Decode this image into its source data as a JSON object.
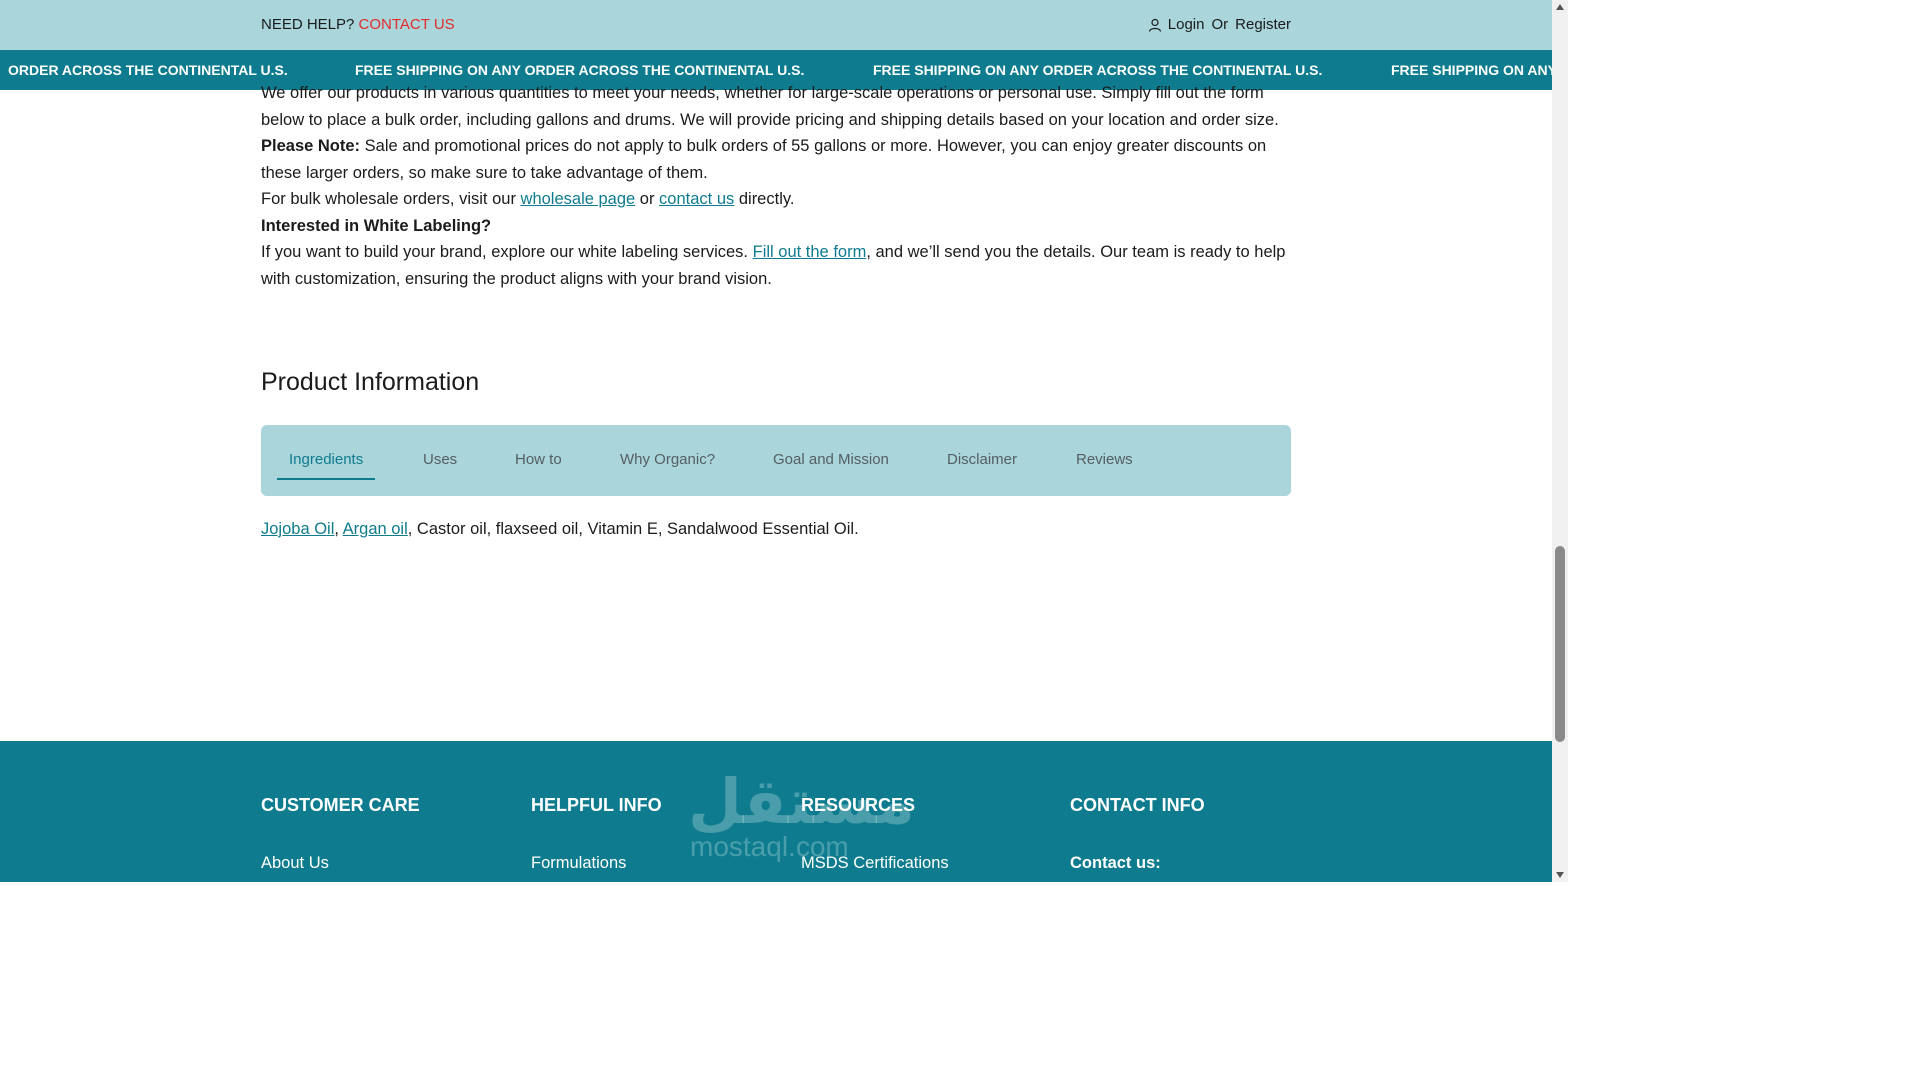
{
  "topbar": {
    "help_label": "NEED HELP?",
    "contact_label": "CONTACT US",
    "login_label": "Login",
    "or_label": "Or",
    "register_label": "Register"
  },
  "marquee": {
    "items": [
      "ORDER ACROSS THE CONTINENTAL U.S.",
      "FREE SHIPPING ON ANY ORDER ACROSS THE CONTINENTAL U.S.",
      "FREE SHIPPING ON ANY ORDER ACROSS THE CONTINENTAL U.S.",
      "FREE SHIPPING ON ANY"
    ]
  },
  "content": {
    "para1": "We offer our products in various quantities to meet your needs, whether for large-scale operations or personal use. Simply fill out the form below to place a bulk order, including gallons and drums. We will provide pricing and shipping details based on your location and order size.",
    "note_label": "Please Note:",
    "note_text": " Sale and promotional prices do not apply to bulk orders of 55 gallons or more. However, you can enjoy greater discounts on these larger orders, so make sure to take advantage of them.",
    "bulk_prefix": "For bulk wholesale orders, visit our ",
    "wholesale_link": "wholesale page",
    "bulk_or": " or ",
    "contact_link": "contact us",
    "bulk_suffix": " directly.",
    "white_label_title": "Interested in White Labeling?",
    "white_prefix": "If you want to build your brand, explore our white labeling services. ",
    "form_link": "Fill out the form",
    "white_suffix": ", and we’ll send you the details. Our team is ready to help with customization, ensuring the product aligns with your brand vision."
  },
  "product_info": {
    "title": "Product Information",
    "tabs": [
      {
        "label": "Ingredients",
        "active": true
      },
      {
        "label": "Uses"
      },
      {
        "label": "How to"
      },
      {
        "label": "Why Organic?"
      },
      {
        "label": "Goal and Mission"
      },
      {
        "label": "Disclaimer"
      },
      {
        "label": "Reviews"
      }
    ],
    "ingredients": {
      "link1": "Jojoba Oil",
      "sep1": ", ",
      "link2": "Argan oil",
      "rest": ", Castor oil, flaxseed oil, Vitamin E, Sandalwood Essential Oil."
    }
  },
  "footer": {
    "columns": [
      {
        "title": "CUSTOMER CARE",
        "first_link": "About Us"
      },
      {
        "title": "HELPFUL INFO",
        "first_link": "Formulations"
      },
      {
        "title": "RESOURCES",
        "first_link": "MSDS Certifications"
      },
      {
        "title": "CONTACT INFO",
        "first_link": "Contact us:"
      }
    ],
    "watermark_arabic": "مستقل",
    "watermark_latin": "mostaql.com"
  },
  "colors": {
    "topbar_bg": "#a9d5db",
    "brand_teal": "#0e7c8e",
    "contact_red": "#e32b2b"
  }
}
